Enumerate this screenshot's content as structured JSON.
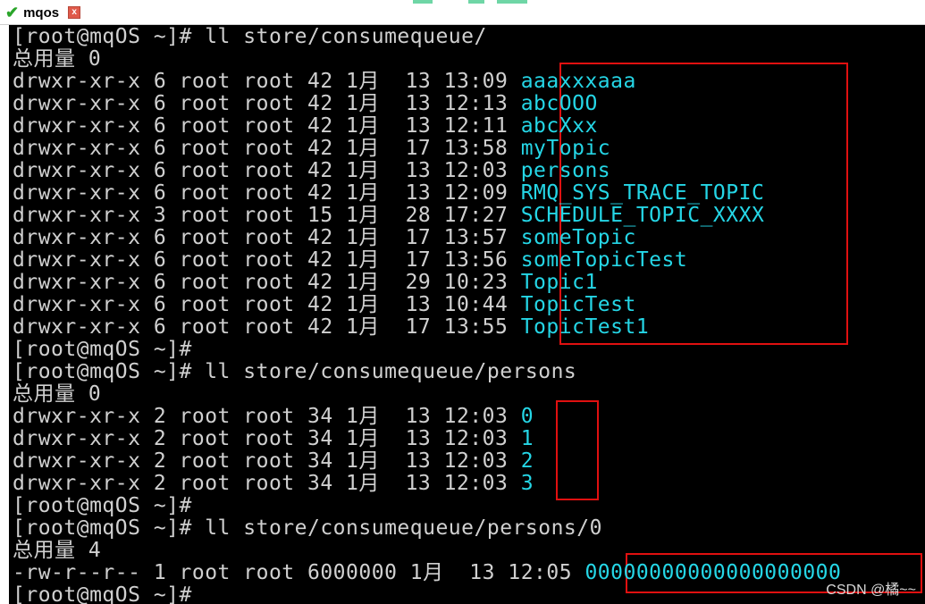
{
  "tab": {
    "title": "mqos",
    "close": "x"
  },
  "terminal": {
    "lines": [
      {
        "plain": "[root@mqOS ~]# ll store/consumequeue/",
        "name": ""
      },
      {
        "plain": "总用量 0",
        "name": ""
      },
      {
        "plain": "drwxr-xr-x 6 root root 42 1月  13 13:09 ",
        "name": "aaaxxxaaa"
      },
      {
        "plain": "drwxr-xr-x 6 root root 42 1月  13 12:13 ",
        "name": "abcOOO"
      },
      {
        "plain": "drwxr-xr-x 6 root root 42 1月  13 12:11 ",
        "name": "abcXxx"
      },
      {
        "plain": "drwxr-xr-x 6 root root 42 1月  17 13:58 ",
        "name": "myTopic"
      },
      {
        "plain": "drwxr-xr-x 6 root root 42 1月  13 12:03 ",
        "name": "persons"
      },
      {
        "plain": "drwxr-xr-x 6 root root 42 1月  13 12:09 ",
        "name": "RMQ_SYS_TRACE_TOPIC"
      },
      {
        "plain": "drwxr-xr-x 3 root root 15 1月  28 17:27 ",
        "name": "SCHEDULE_TOPIC_XXXX"
      },
      {
        "plain": "drwxr-xr-x 6 root root 42 1月  17 13:57 ",
        "name": "someTopic"
      },
      {
        "plain": "drwxr-xr-x 6 root root 42 1月  17 13:56 ",
        "name": "someTopicTest"
      },
      {
        "plain": "drwxr-xr-x 6 root root 42 1月  29 10:23 ",
        "name": "Topic1"
      },
      {
        "plain": "drwxr-xr-x 6 root root 42 1月  13 10:44 ",
        "name": "TopicTest"
      },
      {
        "plain": "drwxr-xr-x 6 root root 42 1月  17 13:55 ",
        "name": "TopicTest1"
      },
      {
        "plain": "[root@mqOS ~]#",
        "name": ""
      },
      {
        "plain": "[root@mqOS ~]# ll store/consumequeue/persons",
        "name": ""
      },
      {
        "plain": "总用量 0",
        "name": ""
      },
      {
        "plain": "drwxr-xr-x 2 root root 34 1月  13 12:03 ",
        "name": "0"
      },
      {
        "plain": "drwxr-xr-x 2 root root 34 1月  13 12:03 ",
        "name": "1"
      },
      {
        "plain": "drwxr-xr-x 2 root root 34 1月  13 12:03 ",
        "name": "2"
      },
      {
        "plain": "drwxr-xr-x 2 root root 34 1月  13 12:03 ",
        "name": "3"
      },
      {
        "plain": "[root@mqOS ~]#",
        "name": ""
      },
      {
        "plain": "[root@mqOS ~]# ll store/consumequeue/persons/0",
        "name": ""
      },
      {
        "plain": "总用量 4",
        "name": ""
      },
      {
        "plain": "-rw-r--r-- 1 root root 6000000 1月  13 12:05 ",
        "name": "00000000000000000000"
      },
      {
        "plain": "[root@mqOS ~]#",
        "name": ""
      }
    ]
  },
  "watermark": "CSDN @橘~~",
  "colors": {
    "background": "#000000",
    "text": "#d0d0d0",
    "directory": "#25d6e6",
    "highlight_box": "#e01010"
  }
}
